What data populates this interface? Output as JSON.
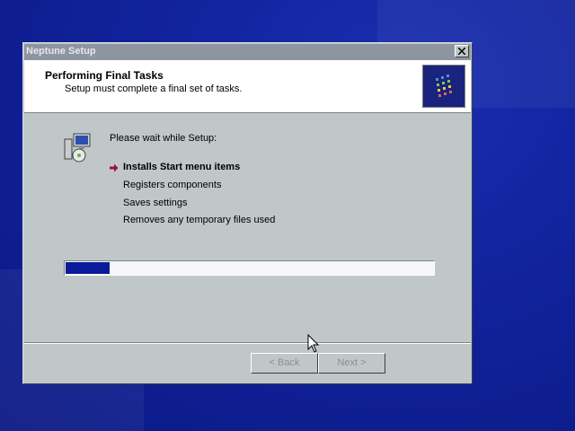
{
  "window": {
    "title": "Neptune Setup",
    "close_icon": "close-icon"
  },
  "header": {
    "title": "Performing Final Tasks",
    "subtitle": "Setup must complete a final set of tasks.",
    "logo_icon": "setup-logo-icon"
  },
  "body": {
    "icon": "installer-computer-icon",
    "intro": "Please wait while Setup:",
    "tasks": [
      {
        "label": "Installs Start menu items",
        "active": true
      },
      {
        "label": "Registers components",
        "active": false
      },
      {
        "label": "Saves settings",
        "active": false
      },
      {
        "label": "Removes any temporary files used",
        "active": false
      }
    ],
    "progress": 0.12
  },
  "buttons": {
    "back": "< Back",
    "next": "Next >"
  },
  "colors": {
    "desktop": "#1224a0",
    "dialog": "#c0c7c8",
    "progress_fill": "#0a1a9a",
    "arrow": "#a0103a"
  }
}
